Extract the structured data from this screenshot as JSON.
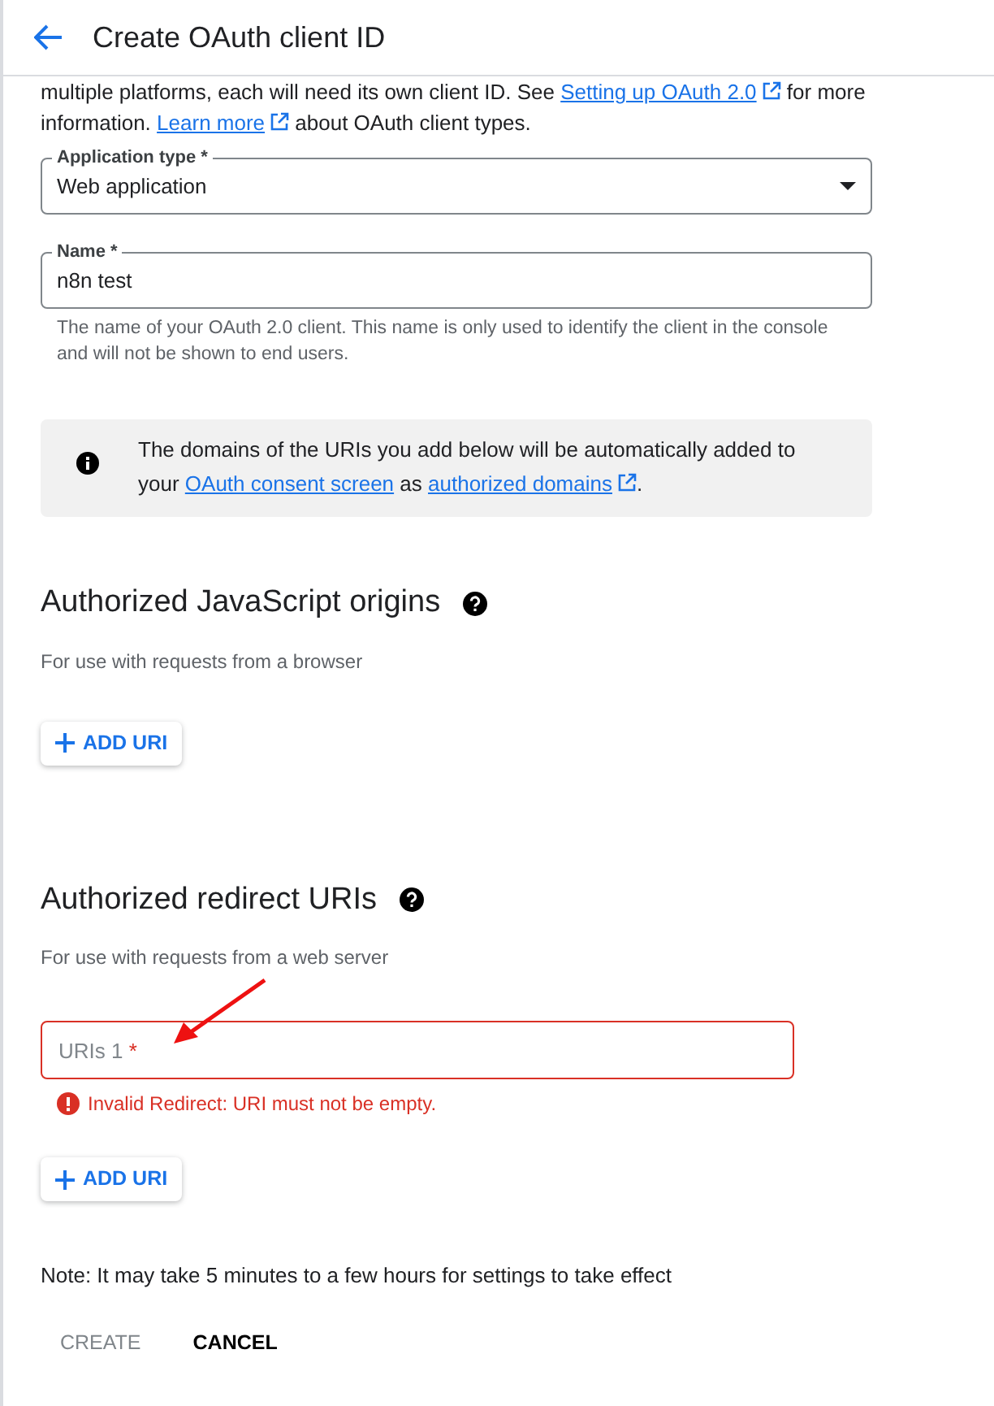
{
  "header": {
    "title": "Create OAuth client ID"
  },
  "intro": [
    [
      {
        "kind": "text",
        "text": "multiple platforms, each will need its own client ID. See "
      },
      {
        "kind": "link",
        "text": "Setting up OAuth 2.0",
        "external": true
      },
      {
        "kind": "text",
        "text": " for more"
      }
    ],
    [
      {
        "kind": "text",
        "text": "information. "
      },
      {
        "kind": "link",
        "text": "Learn more",
        "external": true
      },
      {
        "kind": "text",
        "text": " about OAuth client types."
      }
    ]
  ],
  "fields": [
    {
      "kind": "select",
      "label": "Application type *",
      "value": "Web application"
    },
    {
      "kind": "text",
      "label": "Name *",
      "value": "n8n test",
      "hint": "The name of your OAuth 2.0 client. This name is only used to identify the client in the console and will not be shown to end users."
    }
  ],
  "notice": [
    {
      "kind": "text",
      "text": "The domains of the URIs you add below will be automatically added to your "
    },
    {
      "kind": "link",
      "text": "OAuth consent screen",
      "external": false
    },
    {
      "kind": "text",
      "text": " as "
    },
    {
      "kind": "link",
      "text": "authorized domains",
      "external": true
    },
    {
      "kind": "text",
      "text": "."
    }
  ],
  "sections": [
    {
      "title": "Authorized JavaScript origins",
      "subtitle": "For use with requests from a browser",
      "add_button": "ADD URI"
    },
    {
      "title": "Authorized redirect URIs",
      "subtitle": "For use with requests from a web server",
      "uris": [
        {
          "placeholder": "URIs 1",
          "required": "*",
          "invalid": true,
          "error": "Invalid Redirect: URI must not be empty."
        }
      ],
      "add_button": "ADD URI"
    }
  ],
  "note": "Note: It may take 5 minutes to a few hours for settings to take effect",
  "actions": [
    {
      "label": "CREATE",
      "disabled": true
    },
    {
      "label": "CANCEL",
      "disabled": false
    }
  ]
}
